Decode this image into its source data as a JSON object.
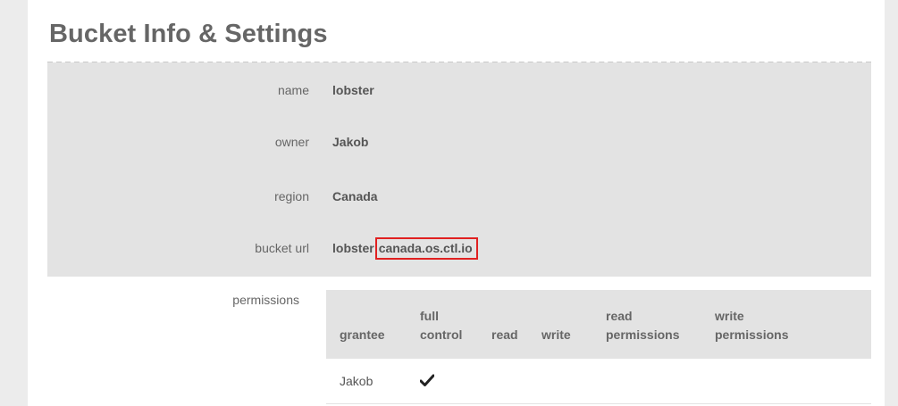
{
  "page": {
    "title": "Bucket Info & Settings"
  },
  "bucket_info": {
    "rows": [
      {
        "label": "name",
        "value": "lobster"
      },
      {
        "label": "owner",
        "value": "Jakob"
      },
      {
        "label": "region",
        "value": "Canada"
      }
    ],
    "url_row": {
      "label": "bucket url",
      "prefix": "lobster",
      "host": "canada.os.ctl.io"
    }
  },
  "permissions": {
    "label": "permissions",
    "columns": [
      {
        "line1": "",
        "line2": "grantee"
      },
      {
        "line1": "full",
        "line2": "control"
      },
      {
        "line1": "",
        "line2": "read"
      },
      {
        "line1": "",
        "line2": "write"
      },
      {
        "line1": "read",
        "line2": "permissions"
      },
      {
        "line1": "write",
        "line2": "permissions"
      }
    ],
    "rows": [
      {
        "grantee": "Jakob",
        "full_control": true,
        "read": false,
        "write": false,
        "read_permissions": false,
        "write_permissions": false
      }
    ]
  },
  "icons": {
    "check": "checkmark-icon"
  },
  "colors": {
    "highlight_border": "#e02020",
    "panel_background": "#e3e3e3",
    "sidebar_background": "#ececec"
  }
}
